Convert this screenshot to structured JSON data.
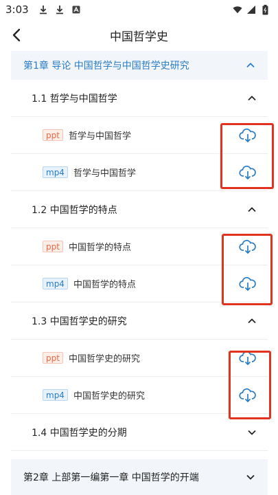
{
  "status_bar": {
    "time": "3:03"
  },
  "app_bar": {
    "title": "中国哲学史"
  },
  "chapter1": {
    "label": "第1章 导论 中国哲学与中国哲学史研究"
  },
  "sections": [
    {
      "label": "1.1 哲学与中国哲学",
      "items": [
        {
          "tag": "ppt",
          "label": "哲学与中国哲学"
        },
        {
          "tag": "mp4",
          "label": "哲学与中国哲学"
        }
      ]
    },
    {
      "label": "1.2 中国哲学的特点",
      "items": [
        {
          "tag": "ppt",
          "label": "中国哲学的特点"
        },
        {
          "tag": "mp4",
          "label": "中国哲学的特点"
        }
      ]
    },
    {
      "label": "1.3 中国哲学史的研究",
      "items": [
        {
          "tag": "ppt",
          "label": "中国哲学史的研究"
        },
        {
          "tag": "mp4",
          "label": "中国哲学史的研究"
        }
      ]
    },
    {
      "label": "1.4 中国哲学史的分期",
      "items": []
    }
  ],
  "chapter2": {
    "label": "第2章 上部第一编第一章 中国哲学的开端"
  },
  "colors": {
    "accent": "#2a7cc7",
    "ppt": "#e8684a",
    "highlight": "#e0321c"
  }
}
